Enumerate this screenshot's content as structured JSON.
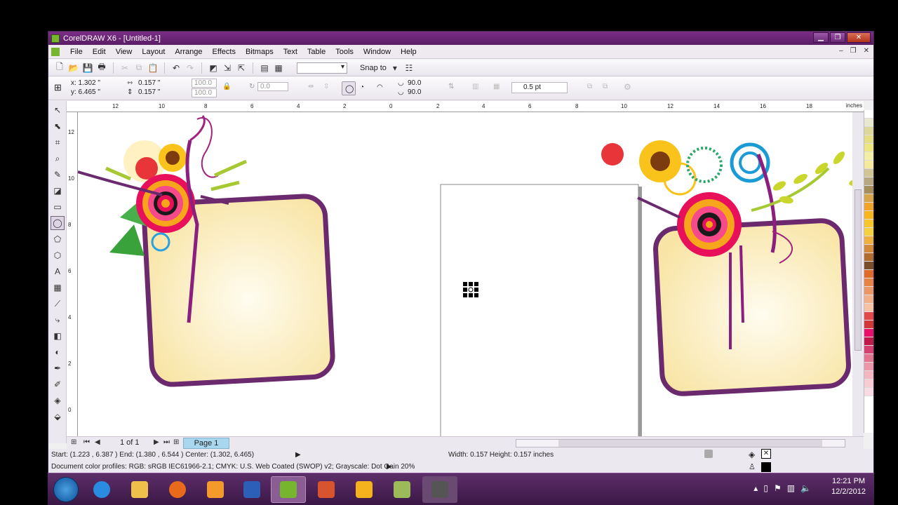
{
  "window": {
    "title": "CorelDRAW X6 - [Untitled-1]",
    "minimize": "▁",
    "restore": "❐",
    "close": "✕"
  },
  "menu": [
    "File",
    "Edit",
    "View",
    "Layout",
    "Arrange",
    "Effects",
    "Bitmaps",
    "Text",
    "Table",
    "Tools",
    "Window",
    "Help"
  ],
  "toolbar": {
    "snap_to": "Snap to",
    "zoom_value": ""
  },
  "property_bar": {
    "x": "x: 1.302 \"",
    "y": "y: 6.465 \"",
    "w": "0.157 \"",
    "h": "0.157 \"",
    "scale_w": "100.0",
    "scale_h": "100.0",
    "rotation": "0.0",
    "angle_start": "90.0",
    "angle_end": "90.0",
    "outline_width": "0.5 pt"
  },
  "ruler": {
    "units": "inches",
    "h_ticks": [
      "12",
      "10",
      "8",
      "6",
      "4",
      "2",
      "0",
      "2",
      "4",
      "6",
      "8",
      "10",
      "12",
      "14",
      "16",
      "18"
    ],
    "v_ticks": [
      "12",
      "10",
      "8",
      "6",
      "4",
      "2",
      "0"
    ]
  },
  "pages": {
    "counter": "1 of 1",
    "tab_label": "Page 1"
  },
  "status": {
    "line_info": "Start: (1.223 , 6.387 )  End: (1.380 , 6.544 )  Center: (1.302, 6.465)",
    "size_info": "Width: 0.157  Height: 0.157  inches",
    "color_profiles": "Document color profiles: RGB: sRGB IEC61966-2.1; CMYK: U.S. Web Coated (SWOP) v2; Grayscale: Dot Gain 20%"
  },
  "taskbar": {
    "time": "12:21 PM",
    "date": "12/2/2012"
  },
  "colors": {
    "title_bar": "#6a2878",
    "frame_border": "#6b2a6e",
    "frame_fill": "#fbeeb8",
    "page_tab": "#a9d7f0"
  },
  "palette": [
    "#ffffff",
    "#e8e8d0",
    "#dcd79a",
    "#e5df84",
    "#ece77e",
    "#f3f0a6",
    "#f3ea9e",
    "#cfc596",
    "#b6a981",
    "#a68e5c",
    "#d9a54a",
    "#f0a52a",
    "#f7b51e",
    "#f7c62b",
    "#f5d040",
    "#efb040",
    "#d28a38",
    "#b06d2f",
    "#7a4e2a",
    "#e06a2a",
    "#e88346",
    "#ec9866",
    "#f2b08a",
    "#f6c4a5",
    "#e24a4a",
    "#d23838",
    "#e8106a",
    "#c01a4c",
    "#d54070",
    "#e37590",
    "#eb96aa",
    "#f3b6c2",
    "#f7ccd5",
    "#f9dbe3"
  ]
}
